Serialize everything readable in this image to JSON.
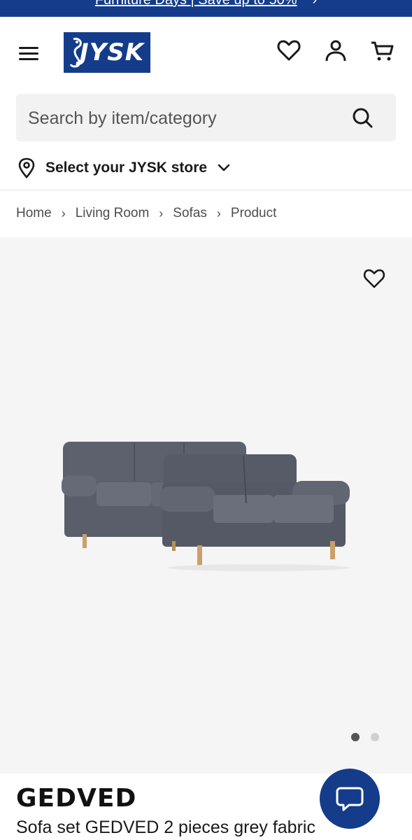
{
  "promo": {
    "text": "Furniture Days | Save up to 50%",
    "chevron": "›"
  },
  "header": {
    "menu_icon": "hamburger-menu-icon",
    "logo_text": "JYSK",
    "icons": [
      "heart-icon",
      "user-icon",
      "cart-icon"
    ]
  },
  "search": {
    "placeholder": "Search by item/category",
    "value": ""
  },
  "store": {
    "label": "Select your JYSK store"
  },
  "breadcrumb": {
    "items": [
      "Home",
      "Living Room",
      "Sofas",
      "Product"
    ],
    "separator": "›"
  },
  "gallery": {
    "slides": 2,
    "active_slide": 1
  },
  "product": {
    "name": "GEDVED",
    "description": "Sofa set GEDVED 2 pieces grey fabric"
  },
  "colors": {
    "brand_blue": "#143c8a",
    "gallery_bg": "#f5f5f5",
    "dot_active": "#555555",
    "dot_inactive": "#d0d0d0"
  }
}
